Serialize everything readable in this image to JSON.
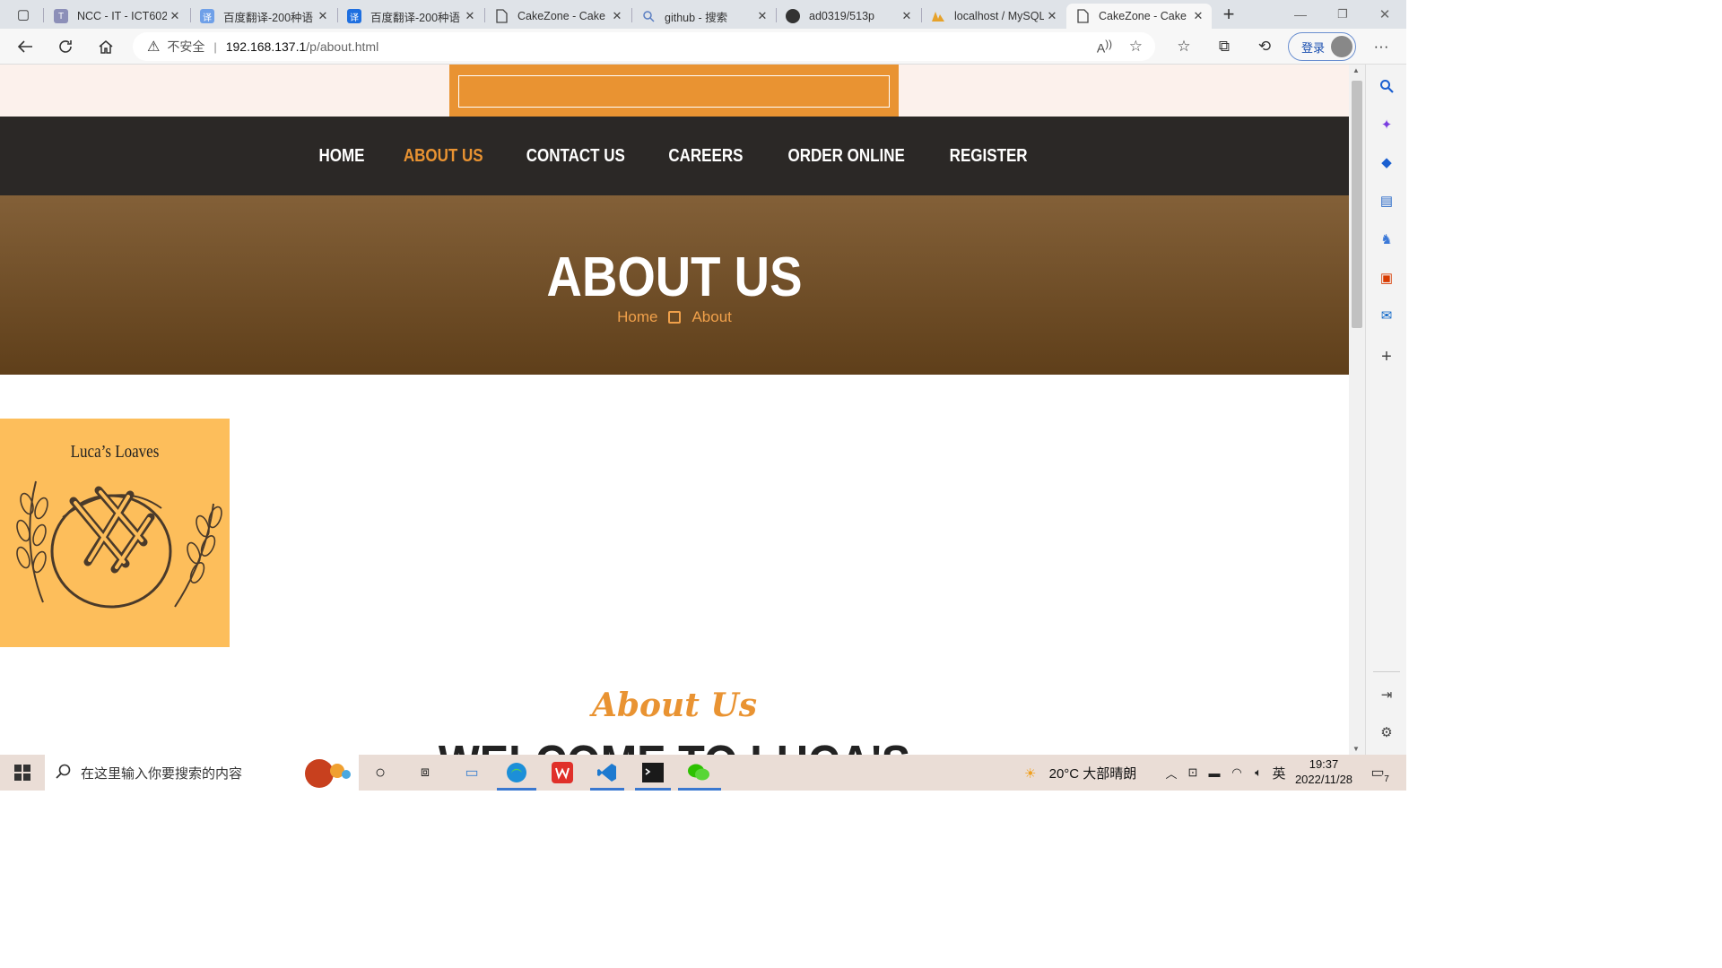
{
  "tabs": [
    {
      "title": "NCC - IT - ICT602",
      "favicon": "T",
      "color": "#8c8fb8"
    },
    {
      "title": "百度翻译-200种语",
      "favicon": "译",
      "color": "#6fa0e8"
    },
    {
      "title": "百度翻译-200种语",
      "favicon": "译",
      "color": "#1e6fe0"
    },
    {
      "title": "CakeZone - Cake",
      "favicon": "page-icon",
      "color": ""
    },
    {
      "title": "github - 搜索",
      "favicon": "search-icon",
      "color": ""
    },
    {
      "title": "ad0319/513p",
      "favicon": "github-icon",
      "color": ""
    },
    {
      "title": "localhost / MySQL",
      "favicon": "phpmyadmin-icon",
      "color": ""
    },
    {
      "title": "CakeZone - Cake",
      "favicon": "page-icon",
      "color": "",
      "active": true
    }
  ],
  "address": {
    "security": "不安全",
    "url_host": "192.168.137.1",
    "url_path": "/p/about.html",
    "login_label": "登录"
  },
  "nav": {
    "items": [
      "HOME",
      "ABOUT US",
      "CONTACT US",
      "CAREERS",
      "ORDER ONLINE",
      "REGISTER"
    ],
    "active": "ABOUT US",
    "accent": "#e99332"
  },
  "hero": {
    "title": "ABOUT US",
    "crumb_home": "Home",
    "crumb_current": "About"
  },
  "logo": {
    "text": "Luca’s Loaves"
  },
  "section": {
    "subtitle": "About Us",
    "heading": "WELCOME TO LUCA'S"
  },
  "taskbar": {
    "search_placeholder": "在这里输入你要搜索的内容",
    "weather": "20°C  大部晴朗",
    "ime": "英",
    "time": "19:37",
    "date": "2022/11/28",
    "notifications": "7"
  }
}
